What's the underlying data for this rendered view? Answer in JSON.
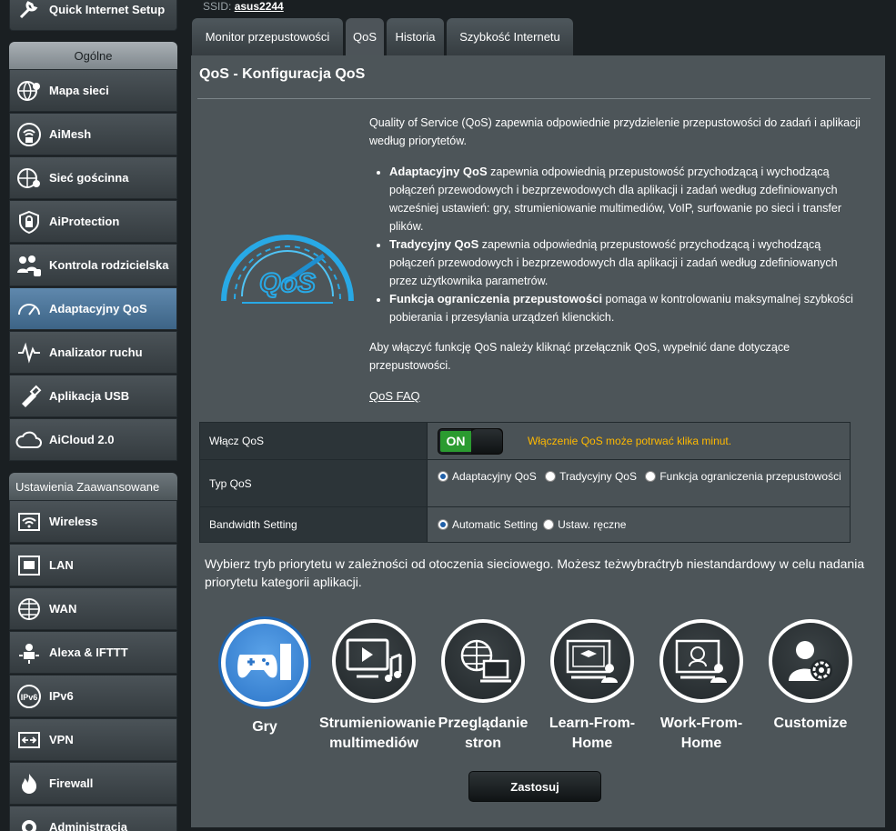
{
  "sidebar": {
    "quick_setup": "Quick Internet Setup",
    "general_header": "Ogólne",
    "general_items": [
      {
        "label": "Mapa sieci",
        "icon": "globe-map-icon"
      },
      {
        "label": "AiMesh",
        "icon": "aimesh-icon"
      },
      {
        "label": "Sieć gościnna",
        "icon": "guest-network-icon"
      },
      {
        "label": "AiProtection",
        "icon": "shield-icon"
      },
      {
        "label": "Kontrola rodzicielska",
        "icon": "family-icon"
      },
      {
        "label": "Adaptacyjny QoS",
        "icon": "speedometer-icon"
      },
      {
        "label": "Analizator ruchu",
        "icon": "traffic-wave-icon"
      },
      {
        "label": "Aplikacja USB",
        "icon": "usb-icon"
      },
      {
        "label": "AiCloud 2.0",
        "icon": "cloud-icon"
      }
    ],
    "advanced_header": "Ustawienia Zaawansowane",
    "advanced_items": [
      {
        "label": "Wireless",
        "icon": "wireless-icon"
      },
      {
        "label": "LAN",
        "icon": "lan-icon"
      },
      {
        "label": "WAN",
        "icon": "wan-globe-icon"
      },
      {
        "label": "Alexa & IFTTT",
        "icon": "alexa-icon"
      },
      {
        "label": "IPv6",
        "icon": "ipv6-icon"
      },
      {
        "label": "VPN",
        "icon": "vpn-icon"
      },
      {
        "label": "Firewall",
        "icon": "firewall-icon"
      },
      {
        "label": "Administracja",
        "icon": "admin-gear-icon"
      }
    ]
  },
  "top": {
    "ssid_label": "SSID:",
    "ssid_value": "asus2244"
  },
  "tabs": [
    "Monitor przepustowości",
    "QoS",
    "Historia",
    "Szybkość Internetu"
  ],
  "main": {
    "title": "QoS - Konfiguracja QoS",
    "intro": "Quality of Service (QoS) zapewnia odpowiednie przydzielenie przepustowości do zadań i aplikacji według priorytetów.",
    "bullets": [
      {
        "bold": "Adaptacyjny QoS",
        "text": " zapewnia odpowiednią przepustowość przychodzącą i wychodzącą połączeń przewodowych i bezprzewodowych dla aplikacji i zadań według zdefiniowanych wcześniej ustawień: gry, strumieniowanie multimediów, VoIP, surfowanie po sieci i transfer plików."
      },
      {
        "bold": "Tradycyjny QoS",
        "text": " zapewnia odpowiednią przepustowość przychodzącą i wychodzącą połączeń przewodowych i bezprzewodowych dla aplikacji i zadań według zdefiniowanych przez użytkownika parametrów."
      },
      {
        "bold": "Funkcja ograniczenia przepustowości",
        "text": " pomaga w kontrolowaniu maksymalnej szybkości pobierania i przesyłania urządzeń klienckich."
      }
    ],
    "enable_text": "Aby włączyć funkcję QoS należy kliknąć przełącznik QoS, wypełnić dane dotyczące przepustowości.",
    "faq": "QoS FAQ",
    "logo_text": "QoS"
  },
  "settings": {
    "enable_label": "Włącz QoS",
    "toggle_state": "ON",
    "enable_note": "Włączenie QoS może potrwać klika minut.",
    "type_label": "Typ QoS",
    "type_options": [
      "Adaptacyjny QoS",
      "Tradycyjny QoS",
      "Funkcja ograniczenia przepustowości"
    ],
    "type_selected": "Adaptacyjny QoS",
    "bandwidth_label": "Bandwidth Setting",
    "bandwidth_options": [
      "Automatic Setting",
      "Ustaw. ręczne"
    ],
    "bandwidth_selected": "Automatic Setting"
  },
  "modes": {
    "prompt": "Wybierz tryb priorytetu w zależności od otoczenia sieciowego. Możesz teżwybraćtryb niestandardowy w celu nadania priorytetu kategorii aplikacji.",
    "items": [
      {
        "label": "Gry",
        "icon": "gamepad-icon",
        "selected": true
      },
      {
        "label": "Strumieniowanie multimediów",
        "icon": "media-stream-icon",
        "selected": false
      },
      {
        "label": "Przeglądanie stron",
        "icon": "web-browse-icon",
        "selected": false
      },
      {
        "label": "Learn-From-Home",
        "icon": "learn-home-icon",
        "selected": false
      },
      {
        "label": "Work-From-Home",
        "icon": "work-home-icon",
        "selected": false
      },
      {
        "label": "Customize",
        "icon": "customize-icon",
        "selected": false
      }
    ]
  },
  "apply_label": "Zastosuj",
  "colors": {
    "accent": "#2d76c9",
    "warning": "#ffb900",
    "toggle_on": "#2b9b30"
  }
}
